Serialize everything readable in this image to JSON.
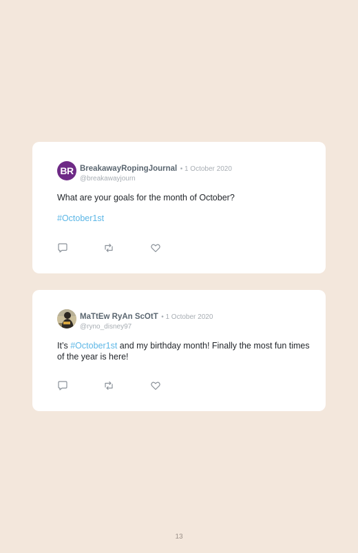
{
  "posts": [
    {
      "avatar_initials": "BR",
      "avatar_color": "#6e2a86",
      "name": "BreakawayRopingJournal",
      "date": "• 1 October 2020",
      "handle": "@breakawayjourn",
      "text": "What are your goals for the month of October?",
      "hashtag": "#October1st"
    },
    {
      "name": "MaTtEw RyAn ScOtT",
      "date": "• 1 October 2020",
      "handle": "@ryno_disney97",
      "text_before": "It’s ",
      "hashtag": "#October1st",
      "text_after": " and my birthday month! Finally the most fun times of the year is here!"
    }
  ],
  "page_number": "13",
  "colors": {
    "background": "#f3e7dc",
    "card": "#ffffff",
    "hashtag": "#5bb6e6",
    "icon": "#8a9199"
  }
}
